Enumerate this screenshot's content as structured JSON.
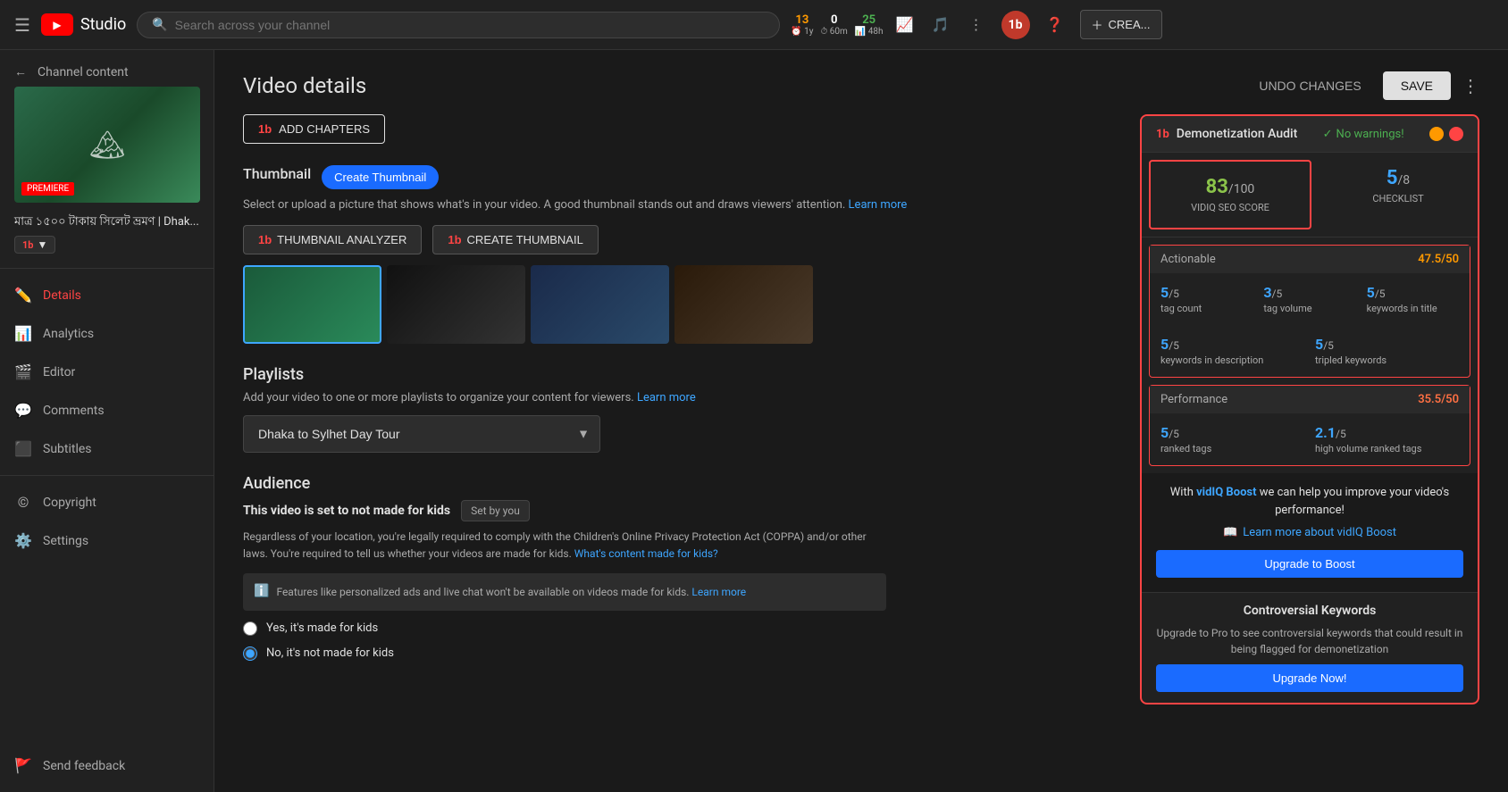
{
  "app": {
    "name": "YouTube Studio",
    "logo_text": "Studio"
  },
  "topnav": {
    "search_placeholder": "Search across your channel",
    "stats": [
      {
        "value": "13",
        "label": "1y",
        "color": "yellow",
        "icon": "clock"
      },
      {
        "value": "0",
        "label": "60m",
        "color": "white",
        "icon": "timer"
      },
      {
        "value": "25",
        "label": "48h",
        "color": "green",
        "icon": "bar"
      },
      {
        "icon": "chart"
      },
      {
        "icon": "music"
      },
      {
        "icon": "menu"
      }
    ],
    "create_label": "CREA..."
  },
  "sidebar": {
    "back_label": "",
    "channel_title": "Channel content",
    "video_title": "মাত্র ১৫০০ টাকায় সিলেট ভ্রমণ | Dhak...",
    "badge_label": "1b▼",
    "nav_items": [
      {
        "id": "details",
        "label": "Details",
        "icon": "pencil",
        "active": true
      },
      {
        "id": "analytics",
        "label": "Analytics",
        "icon": "bar-chart",
        "active": false
      },
      {
        "id": "editor",
        "label": "Editor",
        "icon": "film",
        "active": false
      },
      {
        "id": "comments",
        "label": "Comments",
        "icon": "comment",
        "active": false
      },
      {
        "id": "subtitles",
        "label": "Subtitles",
        "icon": "subtitles",
        "active": false
      },
      {
        "id": "copyright",
        "label": "Copyright",
        "icon": "copyright",
        "active": false
      },
      {
        "id": "settings",
        "label": "Settings",
        "icon": "gear",
        "active": false
      },
      {
        "id": "send-feedback",
        "label": "Send feedback",
        "icon": "flag",
        "active": false
      }
    ]
  },
  "video_details": {
    "page_title": "Video details",
    "undo_label": "UNDO CHANGES",
    "save_label": "SAVE",
    "add_chapters_label": "ADD CHAPTERS",
    "thumbnail": {
      "section_label": "Thumbnail",
      "create_button": "Create Thumbnail",
      "description": "Select or upload a picture that shows what's in your video. A good thumbnail stands out and draws viewers' attention.",
      "learn_more": "Learn more",
      "analyzer_btn": "THUMBNAIL ANALYZER",
      "create_thumb_btn": "CREATE THUMBNAIL"
    },
    "playlists": {
      "title": "Playlists",
      "description": "Add your video to one or more playlists to organize your content for viewers.",
      "learn_more_text": "Learn more",
      "current_playlist": "Dhaka to Sylhet Day Tour"
    },
    "audience": {
      "title": "Audience",
      "status_label": "This video is set to not made for kids",
      "set_by_you": "Set by you",
      "description": "Regardless of your location, you're legally required to comply with the Children's Online Privacy Protection Act (COPPA) and/or other laws. You're required to tell us whether your videos are made for kids.",
      "whats_content_link": "What's content made for kids?",
      "info_text": "Features like personalized ads and live chat won't be available on videos made for kids.",
      "info_link": "Learn more",
      "radio_yes": "Yes, it's made for kids",
      "radio_no": "No, it's not made for kids"
    }
  },
  "audit_panel": {
    "title": "Demonetization Audit",
    "no_warnings": "No warnings!",
    "seo_score": {
      "value": "83",
      "denom": "/100",
      "label": "VIDIQ SEO SCORE"
    },
    "checklist": {
      "value": "5",
      "denom": "/8",
      "label": "CHECKLIST"
    },
    "actionable": {
      "label": "Actionable",
      "score": "47.5",
      "max": "50",
      "metrics": [
        {
          "value": "5",
          "denom": "/5",
          "label": "tag count"
        },
        {
          "value": "3",
          "denom": "/5",
          "label": "tag volume"
        },
        {
          "value": "5",
          "denom": "/5",
          "label": "keywords in title"
        },
        {
          "value": "5",
          "denom": "/5",
          "label": "keywords in description"
        },
        {
          "value": "5",
          "denom": "/5",
          "label": "tripled keywords"
        }
      ]
    },
    "performance": {
      "label": "Performance",
      "score": "35.5",
      "max": "50",
      "metrics": [
        {
          "value": "5",
          "denom": "/5",
          "label": "ranked tags"
        },
        {
          "value": "2.1",
          "denom": "/5",
          "label": "high volume ranked tags"
        }
      ]
    },
    "boost_text": "With vidIQ Boost we can help you improve your video's performance!",
    "learn_boost_label": "Learn more about vidIQ Boost",
    "upgrade_boost_label": "Upgrade to Boost",
    "controversial": {
      "title": "Controversial Keywords",
      "description": "Upgrade to Pro to see controversial keywords that could result in being flagged for demonetization",
      "upgrade_label": "Upgrade Now!"
    }
  }
}
